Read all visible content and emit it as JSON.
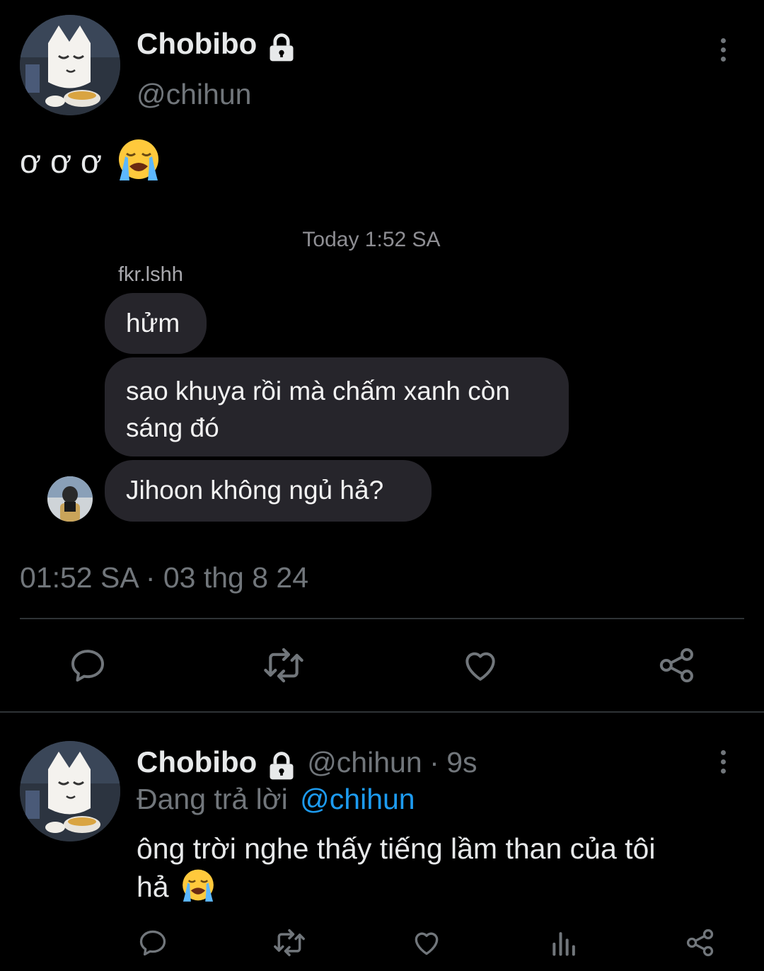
{
  "main_tweet": {
    "display_name": "Chobibo",
    "handle": "@chihun",
    "text": "ơ ơ ơ",
    "emoji": "loudly-crying-face",
    "timestamp": "01:52 SA · 03 thg 8 24"
  },
  "chat_screenshot": {
    "time_header": "Today 1:52 SA",
    "sender": "fkr.lshh",
    "messages": [
      {
        "text": "hửm"
      },
      {
        "text_line1": "sao khuya rồi mà chấm xanh còn",
        "text_line2": "sáng đó"
      },
      {
        "text": "Jihoon không ngủ hả?"
      }
    ]
  },
  "reply_tweet": {
    "display_name": "Chobibo",
    "handle": "@chihun",
    "separator": "·",
    "age": "9s",
    "replying_prefix": "Đang trả lời",
    "replying_to": "@chihun",
    "text_line1": "ông trời nghe thấy tiếng lầm than của tôi",
    "text_line2": "hả",
    "emoji": "loudly-crying-face"
  },
  "colors": {
    "background": "#000000",
    "text": "#e7e9ea",
    "secondary": "#71767b",
    "link": "#1d9bf0",
    "bubble": "#26252b"
  },
  "icons": [
    "lock-icon",
    "more-icon",
    "reply-icon",
    "retweet-icon",
    "like-icon",
    "share-icon",
    "views-icon"
  ]
}
